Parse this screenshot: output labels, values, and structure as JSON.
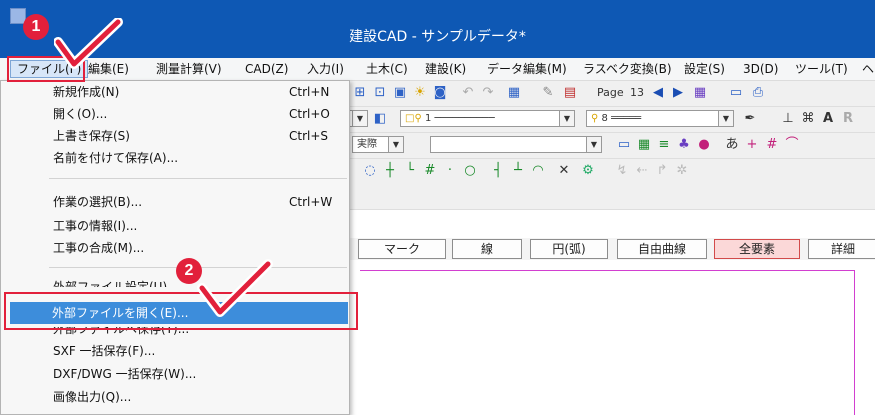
{
  "window": {
    "title": "建設CAD - サンプルデータ*"
  },
  "menubar": {
    "items": [
      "ファイル(F)",
      "編集(E)",
      "測量計算(V)",
      "CAD(Z)",
      "入力(I)",
      "土木(C)",
      "建設(K)",
      "データ編集(M)",
      "ラスベク変換(B)",
      "設定(S)",
      "3D(D)",
      "ツール(T)",
      "ヘ"
    ]
  },
  "file_menu": {
    "items": [
      {
        "label": "新規作成(N)",
        "shortcut": "Ctrl+N"
      },
      {
        "label": "開く(O)...",
        "shortcut": "Ctrl+O"
      },
      {
        "label": "上書き保存(S)",
        "shortcut": "Ctrl+S"
      },
      {
        "label": "名前を付けて保存(A)...",
        "shortcut": ""
      },
      {
        "label": "作業の選択(B)...",
        "shortcut": "Ctrl+W"
      },
      {
        "label": "工事の情報(I)...",
        "shortcut": ""
      },
      {
        "label": "工事の合成(M)...",
        "shortcut": ""
      },
      {
        "label": "外部ファイル設定(U)",
        "shortcut": ""
      },
      {
        "label": "外部ファイルを開く(E)...",
        "shortcut": ""
      },
      {
        "label": "外部ファイルへ保存(T)...",
        "shortcut": ""
      },
      {
        "label": "SXF 一括保存(F)...",
        "shortcut": ""
      },
      {
        "label": "DXF/DWG 一括保存(W)...",
        "shortcut": ""
      },
      {
        "label": "画像出力(Q)...",
        "shortcut": ""
      }
    ]
  },
  "toolbar": {
    "page_label": "Page",
    "page_number": "13",
    "layer_value": "1",
    "pen_value": "8",
    "scale_value": "実際"
  },
  "filter_buttons": [
    "マーク",
    "線",
    "円(弧)",
    "自由曲線",
    "全要素",
    "詳細"
  ],
  "steps": [
    "1",
    "2"
  ],
  "colors": {
    "accent": "#e2203b",
    "titlebar": "#0e58b4",
    "selection": "#3d8ddb"
  }
}
